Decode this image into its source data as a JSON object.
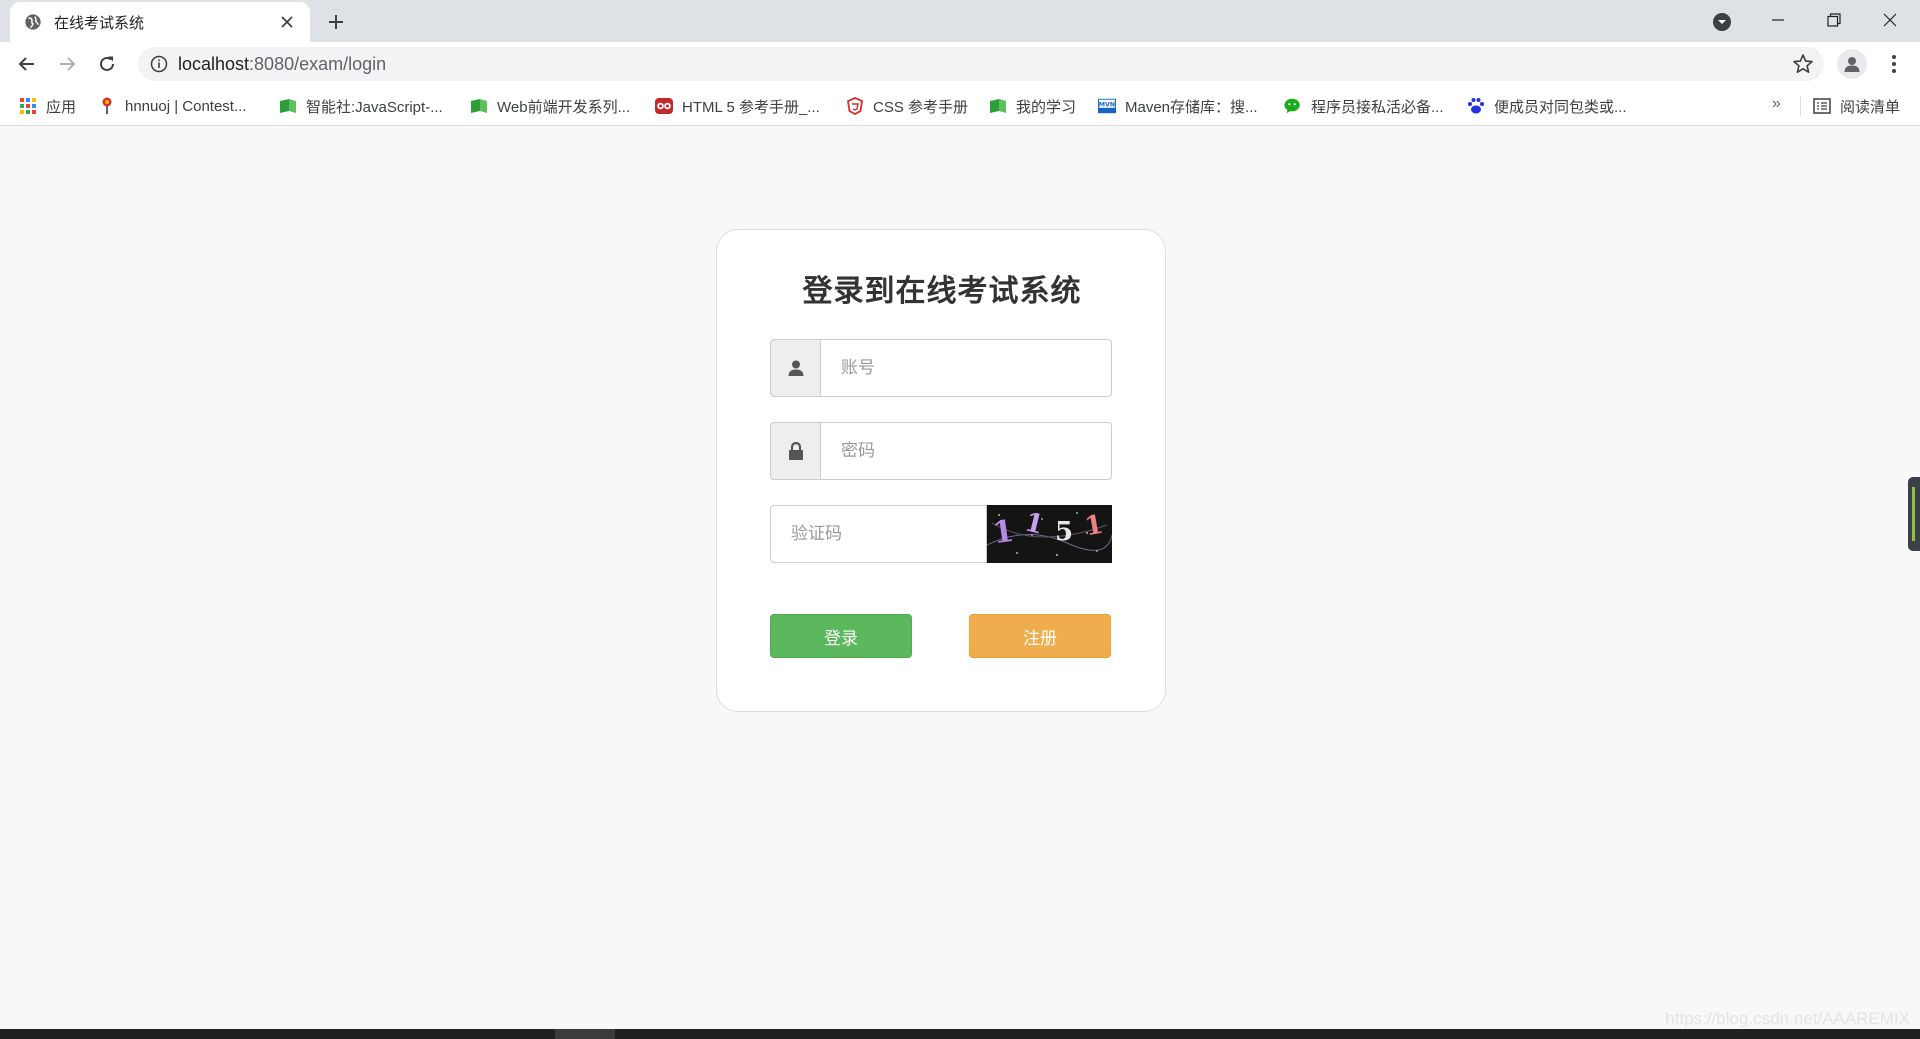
{
  "browser": {
    "tab": {
      "title": "在线考试系统",
      "favicon": "globe-icon"
    },
    "url": {
      "host": "localhost",
      "path": ":8080/exam/login"
    },
    "bookmarks": [
      {
        "label": "应用",
        "icon": "apps-grid-icon"
      },
      {
        "label": "hnnuoj | Contest...",
        "icon": "hnnuoj-icon"
      },
      {
        "label": "智能社:JavaScript-...",
        "icon": "book-green-icon"
      },
      {
        "label": "Web前端开发系列...",
        "icon": "book-green-icon"
      },
      {
        "label": "HTML 5 参考手册_...",
        "icon": "owl-icon"
      },
      {
        "label": "CSS 参考手册",
        "icon": "css-shield-icon"
      },
      {
        "label": "我的学习",
        "icon": "book-green-icon"
      },
      {
        "label": "Maven存储库：搜...",
        "icon": "mvn-icon"
      },
      {
        "label": "程序员接私活必备...",
        "icon": "wechat-icon"
      },
      {
        "label": "便成员对同包类或...",
        "icon": "baidu-paw-icon"
      }
    ],
    "bookmarks_more": "»",
    "reading_list": "阅读清单"
  },
  "login": {
    "title": "登录到在线考试系统",
    "username_placeholder": "账号",
    "password_placeholder": "密码",
    "captcha_placeholder": "验证码",
    "captcha_text": [
      "1",
      "1",
      "5",
      "1"
    ],
    "login_label": "登录",
    "register_label": "注册"
  },
  "watermark": "https://blog.csdn.net/AAAREMIX",
  "colors": {
    "login_button": "#5cb85c",
    "register_button": "#f0ad4e",
    "page_background": "#f8f8f8"
  }
}
